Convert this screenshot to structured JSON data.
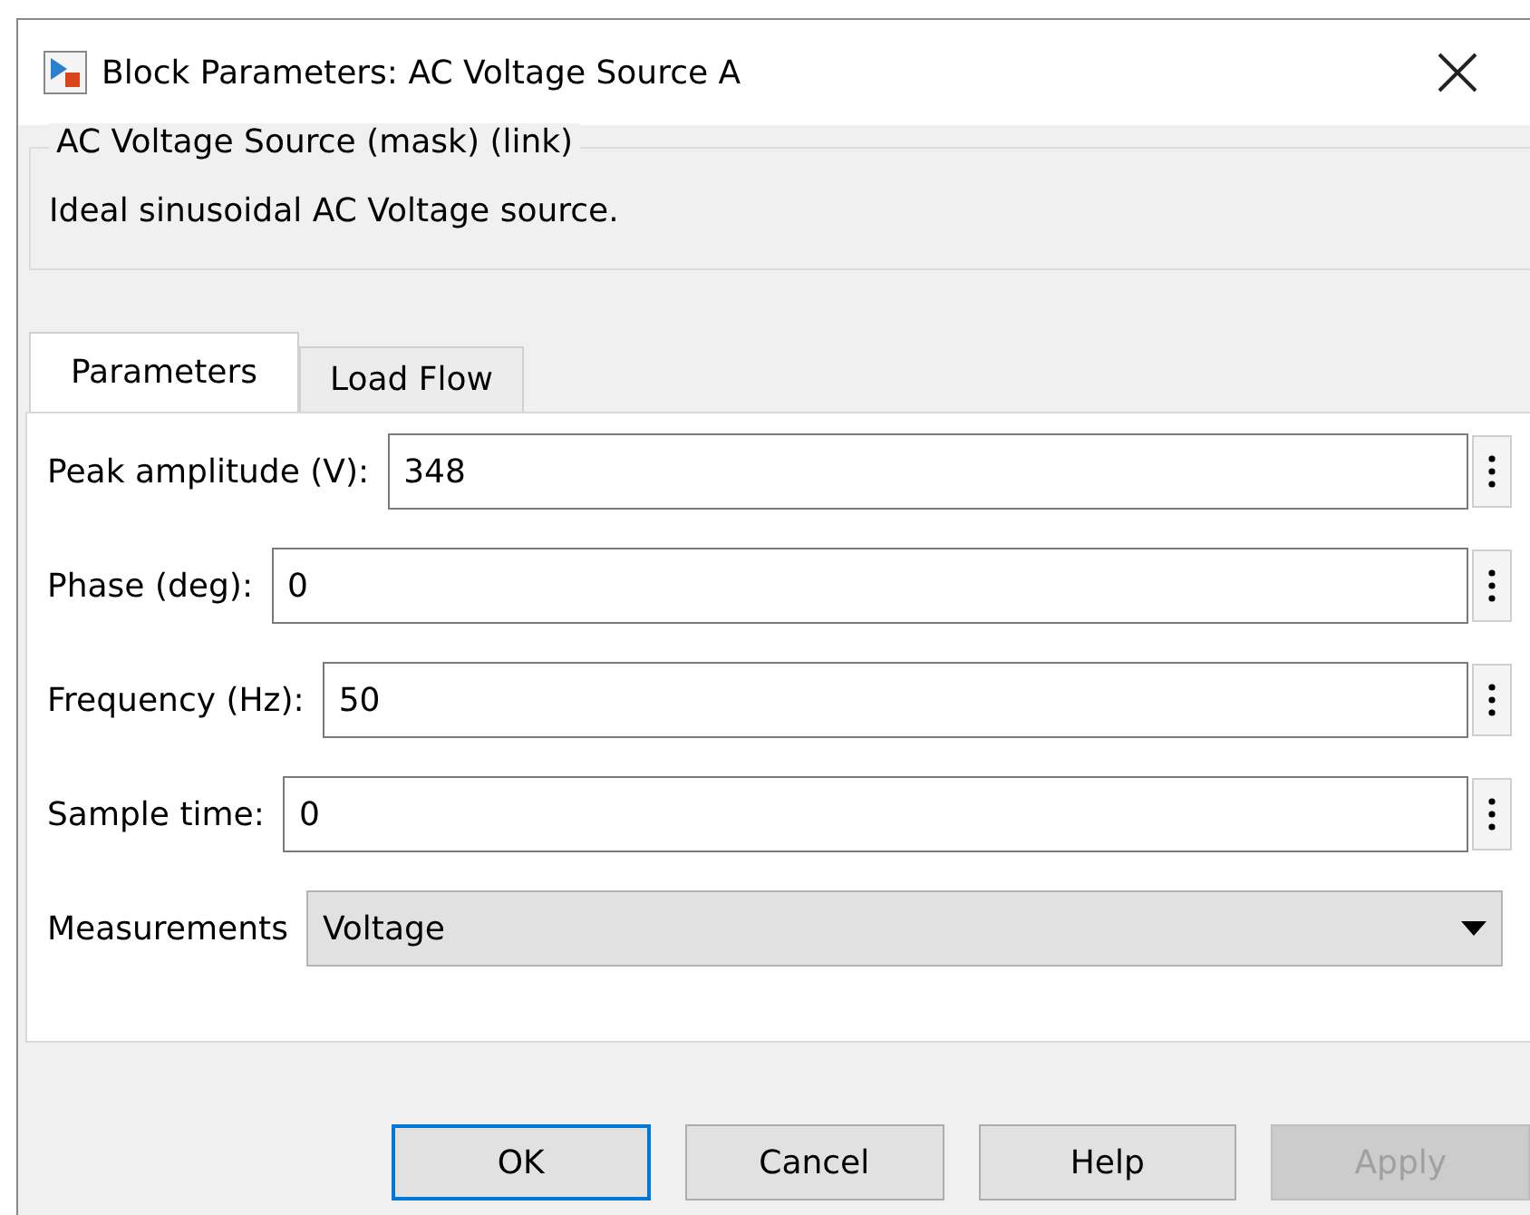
{
  "window": {
    "title": "Block Parameters: AC Voltage Source A"
  },
  "group": {
    "title": "AC Voltage Source (mask) (link)",
    "description": "Ideal sinusoidal AC Voltage source."
  },
  "tabs": [
    {
      "label": "Parameters",
      "selected": true
    },
    {
      "label": "Load Flow",
      "selected": false
    }
  ],
  "parameters": [
    {
      "kind": "field",
      "label": "Peak amplitude (V):",
      "value": "348"
    },
    {
      "kind": "field",
      "label": "Phase (deg):",
      "value": "0"
    },
    {
      "kind": "field",
      "label": "Frequency (Hz):",
      "value": "50"
    },
    {
      "kind": "field",
      "label": "Sample time:",
      "value": "0"
    },
    {
      "kind": "dropdown",
      "label": "Measurements",
      "value": "Voltage"
    }
  ],
  "buttons": [
    {
      "label": "OK",
      "default": true,
      "disabled": false
    },
    {
      "label": "Cancel",
      "default": false,
      "disabled": false
    },
    {
      "label": "Help",
      "default": false,
      "disabled": false
    },
    {
      "label": "Apply",
      "default": false,
      "disabled": true
    }
  ]
}
